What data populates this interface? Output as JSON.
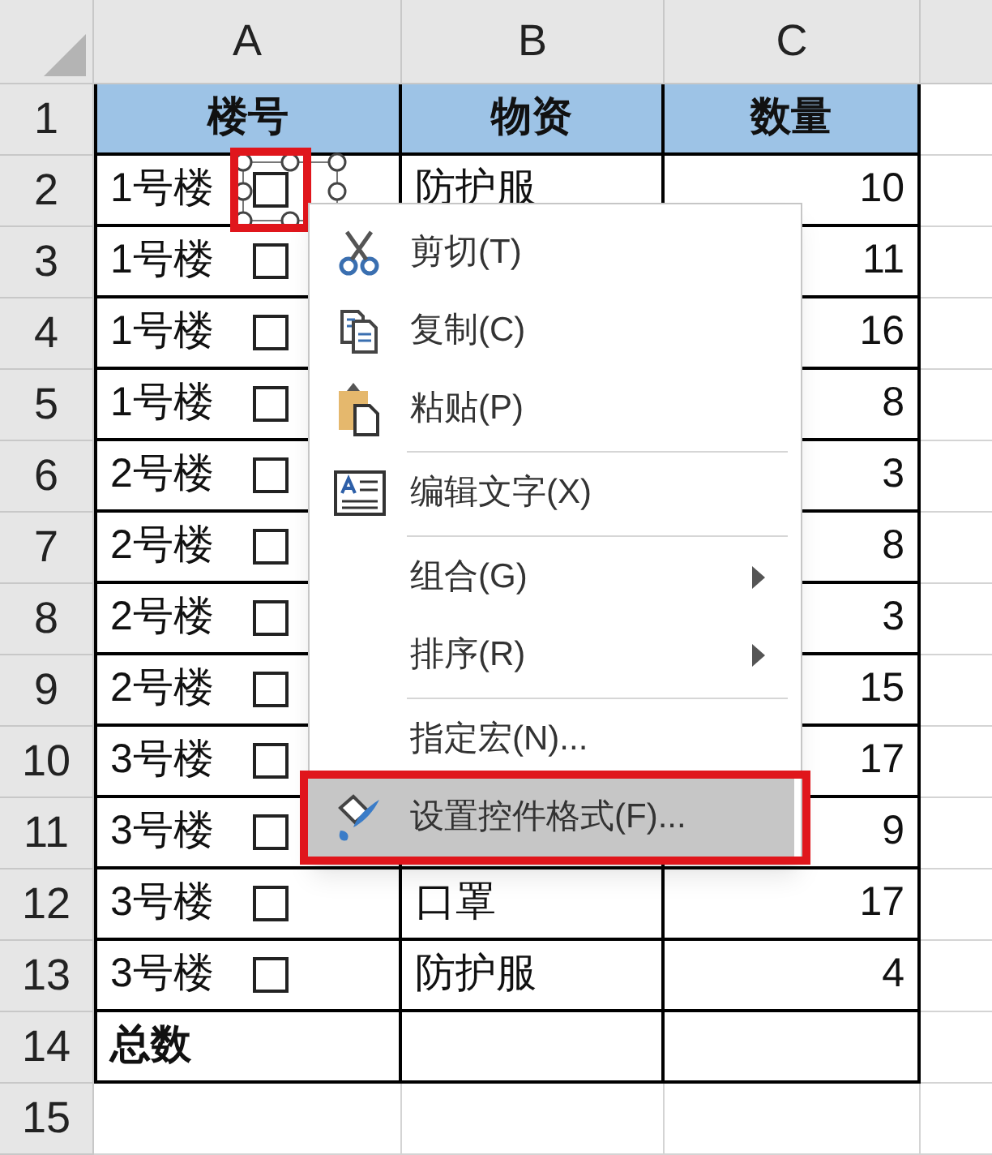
{
  "columns": [
    "A",
    "B",
    "C"
  ],
  "rows": [
    {
      "number": "1",
      "kind": "header",
      "cells": [
        {
          "text": "楼号"
        },
        {
          "text": "物资"
        },
        {
          "text": "数量"
        }
      ]
    },
    {
      "number": "2",
      "kind": "data",
      "cells": [
        {
          "text": "1号楼",
          "checkbox": {
            "checked": false,
            "selected": true,
            "annotated": true
          }
        },
        {
          "text": "防护服"
        },
        {
          "text": "10"
        }
      ]
    },
    {
      "number": "3",
      "kind": "data",
      "cells": [
        {
          "text": "1号楼",
          "checkbox": {
            "checked": false,
            "selected": false,
            "annotated": false
          }
        },
        {},
        {
          "text": "11"
        }
      ]
    },
    {
      "number": "4",
      "kind": "data",
      "cells": [
        {
          "text": "1号楼",
          "checkbox": {
            "checked": false,
            "selected": false,
            "annotated": false
          }
        },
        {},
        {
          "text": "16"
        }
      ]
    },
    {
      "number": "5",
      "kind": "data",
      "cells": [
        {
          "text": "1号楼",
          "checkbox": {
            "checked": false,
            "selected": false,
            "annotated": false
          }
        },
        {},
        {
          "text": "8"
        }
      ]
    },
    {
      "number": "6",
      "kind": "data",
      "cells": [
        {
          "text": "2号楼",
          "checkbox": {
            "checked": false,
            "selected": false,
            "annotated": false
          }
        },
        {},
        {
          "text": "3"
        }
      ]
    },
    {
      "number": "7",
      "kind": "data",
      "cells": [
        {
          "text": "2号楼",
          "checkbox": {
            "checked": false,
            "selected": false,
            "annotated": false
          }
        },
        {},
        {
          "text": "8"
        }
      ]
    },
    {
      "number": "8",
      "kind": "data",
      "cells": [
        {
          "text": "2号楼",
          "checkbox": {
            "checked": false,
            "selected": false,
            "annotated": false
          }
        },
        {},
        {
          "text": "3"
        }
      ]
    },
    {
      "number": "9",
      "kind": "data",
      "cells": [
        {
          "text": "2号楼",
          "checkbox": {
            "checked": false,
            "selected": false,
            "annotated": false
          }
        },
        {},
        {
          "text": "15"
        }
      ]
    },
    {
      "number": "10",
      "kind": "data",
      "cells": [
        {
          "text": "3号楼",
          "checkbox": {
            "checked": false,
            "selected": false,
            "annotated": false
          }
        },
        {},
        {
          "text": "17"
        }
      ]
    },
    {
      "number": "11",
      "kind": "data",
      "cells": [
        {
          "text": "3号楼",
          "checkbox": {
            "checked": false,
            "selected": false,
            "annotated": false
          }
        },
        {},
        {
          "text": "9"
        }
      ]
    },
    {
      "number": "12",
      "kind": "data",
      "cells": [
        {
          "text": "3号楼",
          "checkbox": {
            "checked": false,
            "selected": false,
            "annotated": false
          }
        },
        {
          "text": "口罩"
        },
        {
          "text": "17"
        }
      ]
    },
    {
      "number": "13",
      "kind": "data",
      "cells": [
        {
          "text": "3号楼",
          "checkbox": {
            "checked": false,
            "selected": false,
            "annotated": false
          }
        },
        {
          "text": "防护服"
        },
        {
          "text": "4"
        }
      ]
    },
    {
      "number": "14",
      "kind": "total",
      "cells": [
        {
          "text": "总数"
        },
        {},
        {}
      ]
    },
    {
      "number": "15",
      "kind": "blank",
      "cells": [
        {},
        {},
        {}
      ]
    }
  ],
  "context_menu": {
    "items": [
      {
        "kind": "item",
        "label": "剪切(T)",
        "submenu": false,
        "highlighted": false,
        "annotated": false
      },
      {
        "kind": "item",
        "label": "复制(C)",
        "submenu": false,
        "highlighted": false,
        "annotated": false
      },
      {
        "kind": "item",
        "label": "粘贴(P)",
        "submenu": false,
        "highlighted": false,
        "annotated": false
      },
      {
        "kind": "separator"
      },
      {
        "kind": "item",
        "label": "编辑文字(X)",
        "submenu": false,
        "highlighted": false,
        "annotated": false
      },
      {
        "kind": "separator"
      },
      {
        "kind": "item",
        "label": "组合(G)",
        "submenu": true,
        "highlighted": false,
        "annotated": false
      },
      {
        "kind": "item",
        "label": "排序(R)",
        "submenu": true,
        "highlighted": false,
        "annotated": false
      },
      {
        "kind": "separator"
      },
      {
        "kind": "item",
        "label": "指定宏(N)...",
        "submenu": false,
        "highlighted": false,
        "annotated": false
      },
      {
        "kind": "item",
        "label": "设置控件格式(F)...",
        "submenu": false,
        "highlighted": true,
        "annotated": true
      }
    ]
  }
}
